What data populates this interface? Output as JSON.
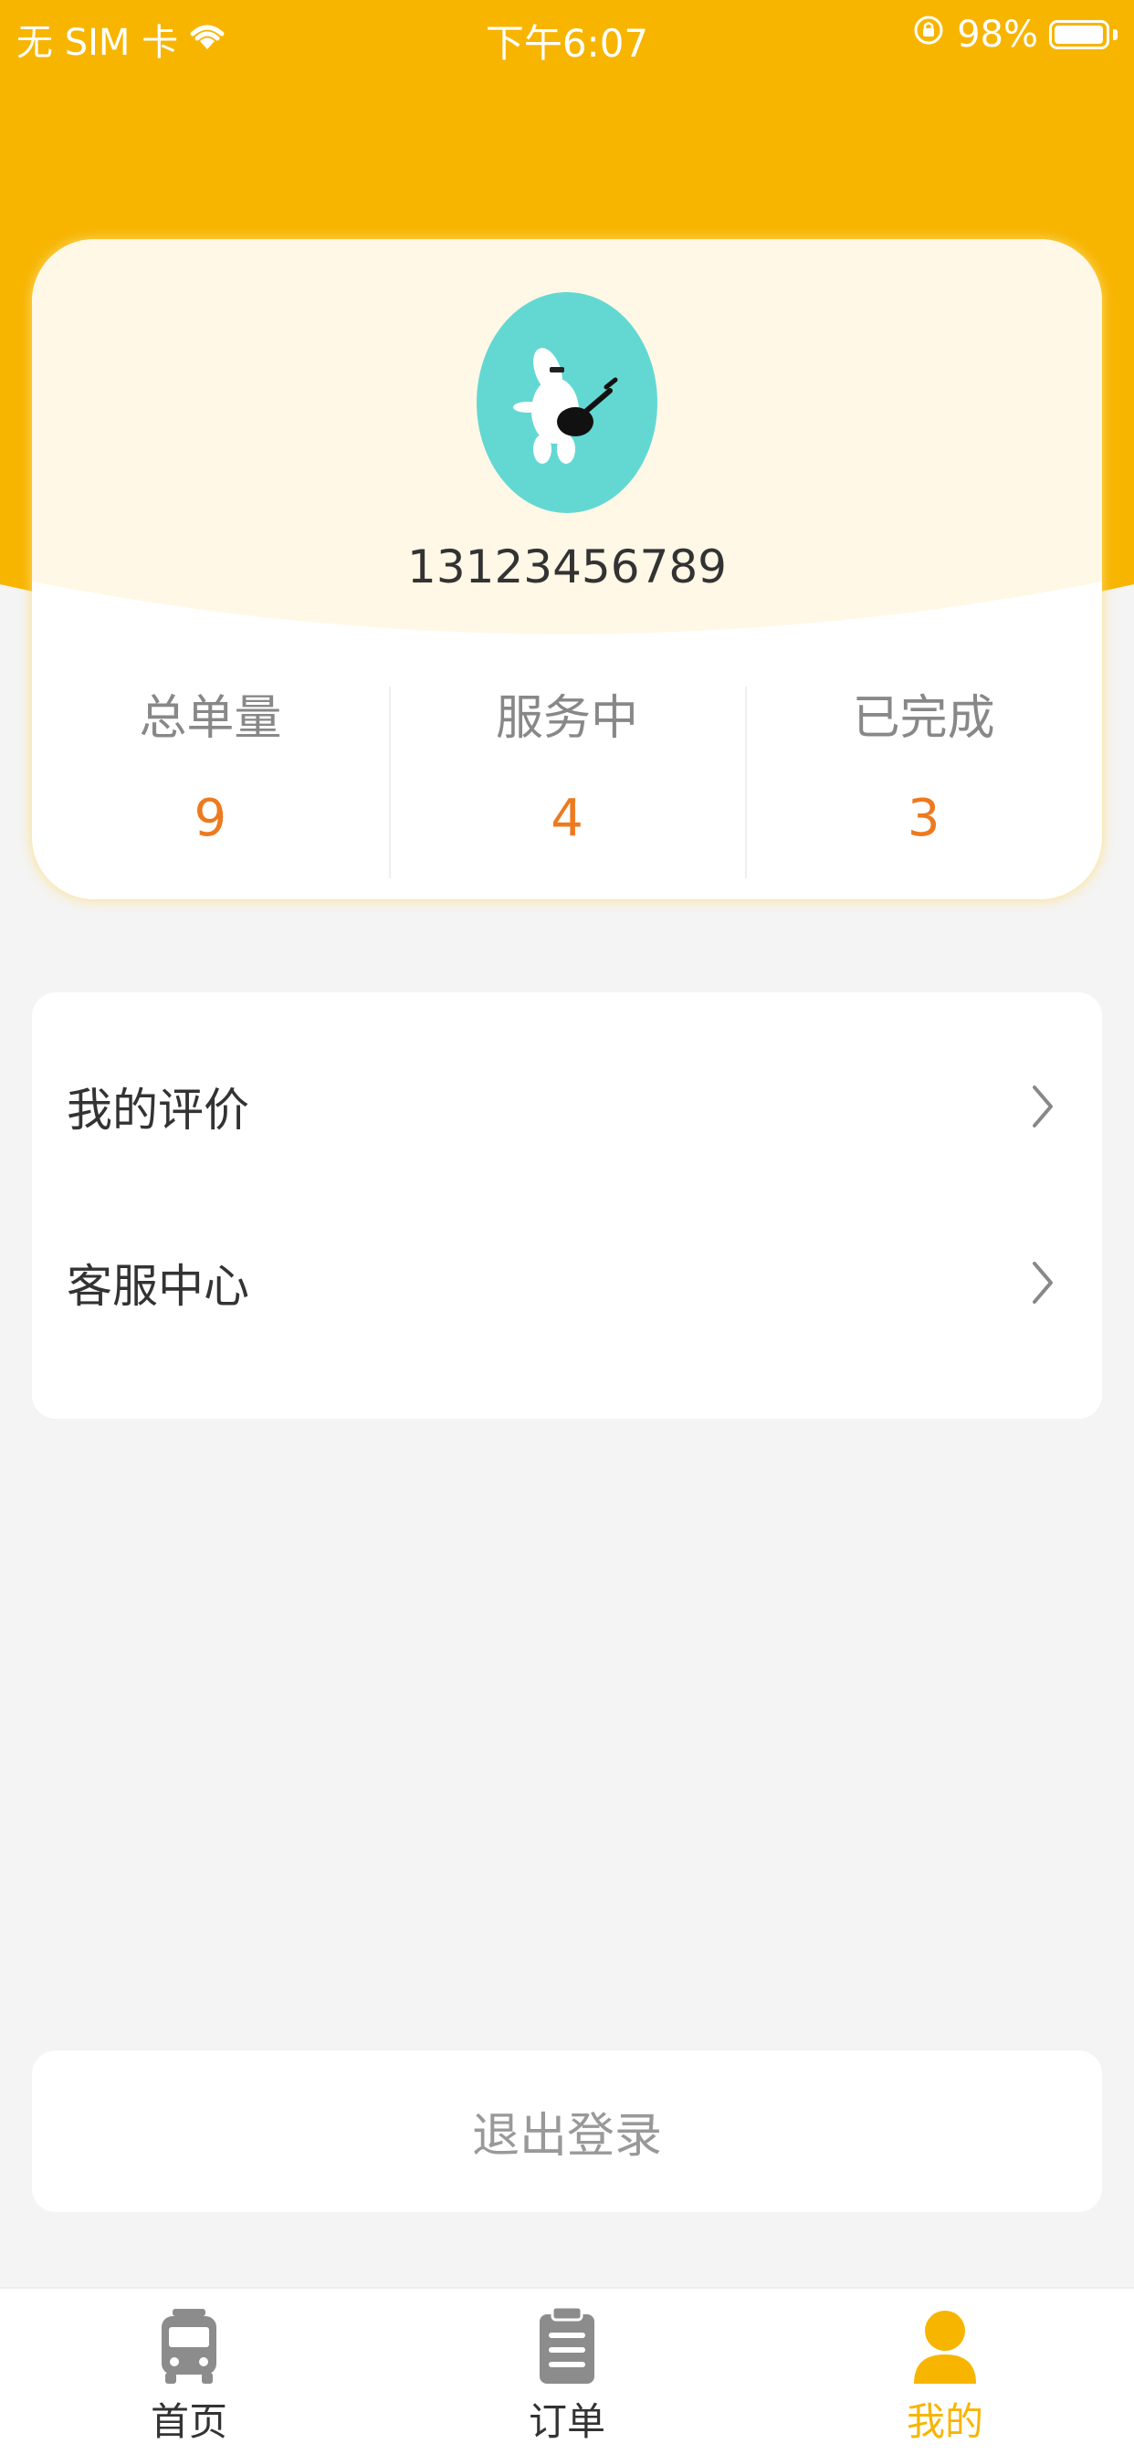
{
  "status_bar": {
    "carrier": "无 SIM 卡",
    "time": "下午6:07",
    "battery": "98%",
    "battery_level": 0.98
  },
  "profile": {
    "phone": "13123456789",
    "avatar_icon": "avatar-guitar-character"
  },
  "stats": [
    {
      "label": "总单量",
      "value": "9"
    },
    {
      "label": "服务中",
      "value": "4"
    },
    {
      "label": "已完成",
      "value": "3"
    }
  ],
  "menu": [
    {
      "label": "我的评价"
    },
    {
      "label": "客服中心"
    }
  ],
  "logout_label": "退出登录",
  "tabs": [
    {
      "label": "首页",
      "icon": "bus-icon",
      "active": false
    },
    {
      "label": "订单",
      "icon": "clipboard-icon",
      "active": false
    },
    {
      "label": "我的",
      "icon": "user-icon",
      "active": true
    }
  ],
  "colors": {
    "brand_yellow": "#F7B500",
    "accent_orange": "#EE7A1F",
    "card_cream": "#FFF8E6",
    "page_bg": "#F4F4F4"
  }
}
